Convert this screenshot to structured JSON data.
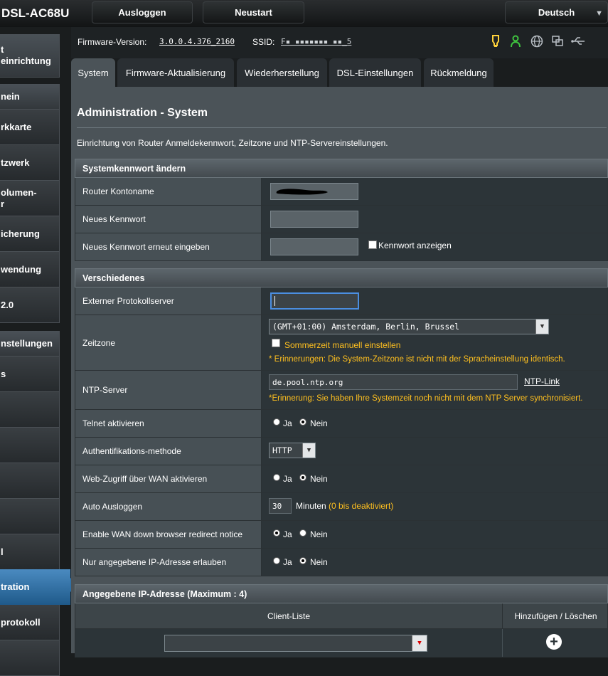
{
  "header": {
    "model": "DSL-AC68U",
    "logout_label": "Ausloggen",
    "restart_label": "Neustart",
    "language": "Deutsch"
  },
  "info": {
    "firmware_label": "Firmware-Version:",
    "firmware_value": "3.0.0.4.376_2160",
    "ssid_label": "SSID:",
    "ssid_value": "F▪ ▪▪▪▪▪▪▪  ▪▪_5",
    "status_icons": [
      "bulb-icon",
      "user-icon",
      "globe-icon",
      "copy-icon",
      "usb-icon"
    ]
  },
  "sidebar": {
    "items": [
      {
        "label": "t\neinrichtung"
      },
      {
        "label": "nein"
      },
      {
        "label": "rkkarte"
      },
      {
        "label": "tzwerk"
      },
      {
        "label": "olumen-\nr"
      },
      {
        "label": "icherung"
      },
      {
        "label": "wendung"
      },
      {
        "label": " 2.0"
      },
      {
        "label": "nstellungen"
      },
      {
        "label": "s"
      },
      {
        "label": ""
      },
      {
        "label": ""
      },
      {
        "label": ""
      },
      {
        "label": ""
      },
      {
        "label": "l"
      },
      {
        "label": "tration"
      },
      {
        "label": "protokoll"
      },
      {
        "label": ""
      }
    ]
  },
  "tabs": [
    "System",
    "Firmware-Aktualisierung",
    "Wiederherstellung",
    "DSL-Einstellungen",
    "Rückmeldung"
  ],
  "page": {
    "title": "Administration - System",
    "description": "Einrichtung von Router Anmeldekennwort, Zeitzone und NTP-Servereinstellungen."
  },
  "password_section": {
    "title": "Systemkennwort ändern",
    "account_label": "Router Kontoname",
    "new_password_label": "Neues Kennwort",
    "confirm_label": "Neues Kennwort erneut eingeben",
    "show_password_label": "Kennwort anzeigen"
  },
  "misc_section": {
    "title": "Verschiedenes",
    "log_server_label": "Externer Protokollserver",
    "timezone_label": "Zeitzone",
    "timezone_value": "(GMT+01:00) Amsterdam, Berlin, Brussel",
    "dst_label": "Sommerzeit manuell einstellen",
    "timezone_warning": "* Erinnerungen: Die System-Zeitzone ist nicht mit der Spracheinstellung identisch.",
    "ntp_label": "NTP-Server",
    "ntp_value": "de.pool.ntp.org",
    "ntp_link": "NTP-Link",
    "ntp_warning": "*Erinnerung: Sie haben Ihre Systemzeit noch nicht mit dem NTP Server synchronisiert.",
    "telnet_label": "Telnet aktivieren",
    "auth_label": "Authentifikations-methode",
    "auth_value": "HTTP",
    "wan_access_label": "Web-Zugriff über WAN aktivieren",
    "autologout_label": "Auto Ausloggen",
    "autologout_value": "30",
    "autologout_unit": "Minuten",
    "autologout_hint": "(0 bis deaktiviert)",
    "wan_redirect_label": "Enable WAN down browser redirect notice",
    "ip_only_label": "Nur angegebene IP-Adresse erlauben",
    "yes": "Ja",
    "no": "Nein"
  },
  "ip_section": {
    "title": "Angegebene IP-Adresse (Maximum : 4)",
    "client_list_header": "Client-Liste",
    "add_delete_header": "Hinzufügen / Löschen"
  },
  "colors": {
    "accent": "#2d6ea3",
    "warning": "#ffc01f",
    "panel": "#4b5358"
  }
}
